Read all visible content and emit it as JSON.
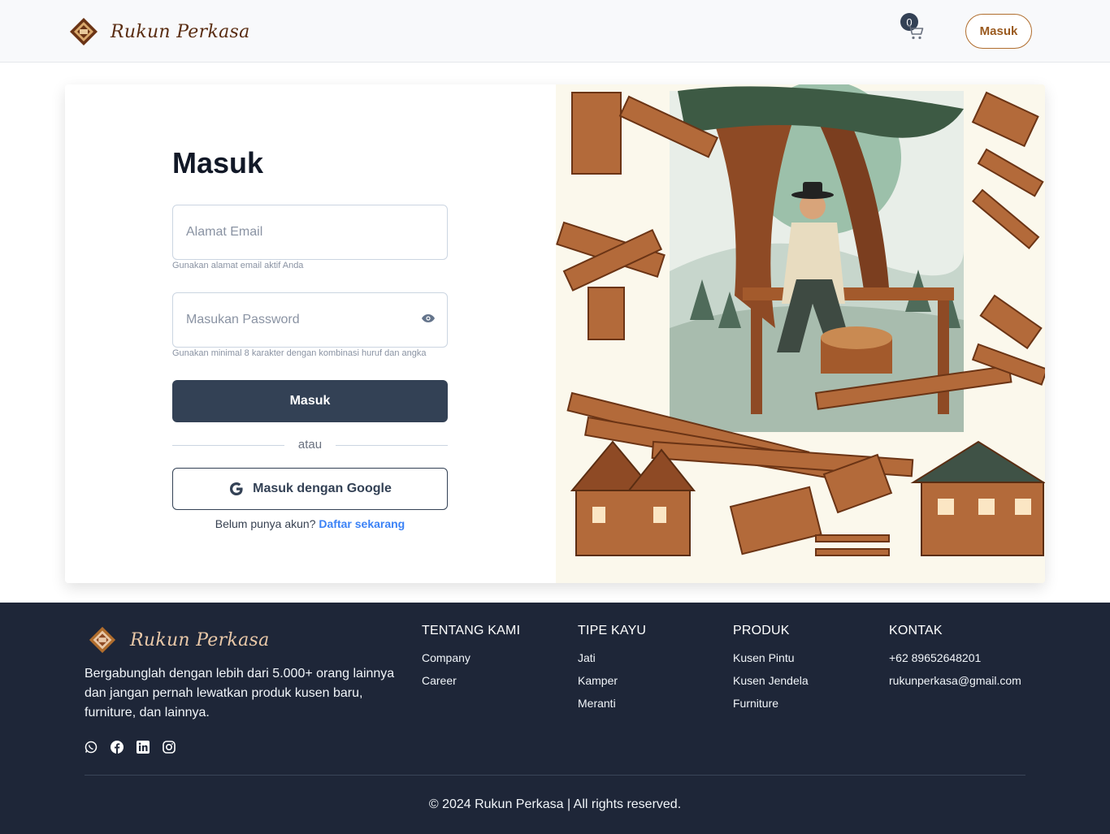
{
  "brand": {
    "name": "Rukun Perkasa",
    "accent": "#b06d2d",
    "dark": "#334155",
    "footer_bg": "#1e2638"
  },
  "header": {
    "cart_count": "0",
    "login_button": "Masuk",
    "cart_icon": "cart-icon"
  },
  "form": {
    "title": "Masuk",
    "email_placeholder": "Alamat Email",
    "email_value": "",
    "email_hint": "Gunakan alamat email aktif Anda",
    "password_placeholder": "Masukan Password",
    "password_value": "",
    "password_hint": "Gunakan minimal 8 karakter dengan kombinasi huruf dan angka",
    "submit_label": "Masuk",
    "divider": "atau",
    "google_label": "Masuk dengan Google",
    "register_prompt": "Belum punya akun?",
    "register_link": "Daftar sekarang"
  },
  "footer": {
    "about": "Bergabunglah dengan lebih dari 5.000+ orang lainnya dan jangan pernah lewatkan produk kusen baru, furniture, dan lainnya.",
    "socials": [
      "whatsapp-icon",
      "facebook-icon",
      "linkedin-icon",
      "instagram-icon"
    ],
    "columns": [
      {
        "title": "TENTANG KAMI",
        "links": [
          "Company",
          "Career"
        ]
      },
      {
        "title": "TIPE KAYU",
        "links": [
          "Jati",
          "Kamper",
          "Meranti"
        ]
      },
      {
        "title": "PRODUK",
        "links": [
          "Kusen Pintu",
          "Kusen Jendela",
          "Furniture"
        ]
      },
      {
        "title": "KONTAK",
        "links": [
          "+62 89652648201",
          "rukunperkasa@gmail.com"
        ]
      }
    ],
    "copyright": "© 2024 Rukun Perkasa | All rights reserved."
  }
}
